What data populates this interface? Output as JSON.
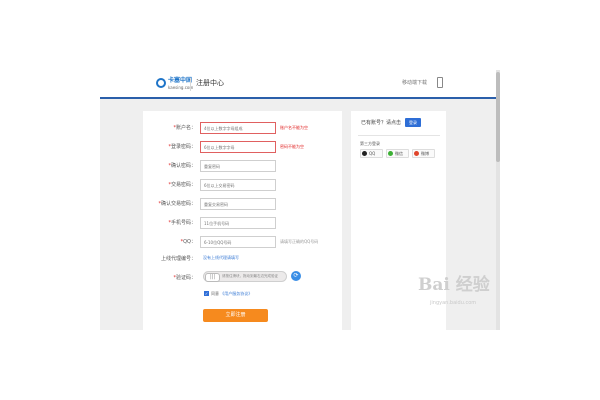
{
  "header": {
    "logo_text": "卡塞中国",
    "logo_sub": "kaesing.com",
    "title": "注册中心",
    "download_text": "移动端下载"
  },
  "form": {
    "fields": [
      {
        "label": "账户名：",
        "placeholder": "4位以上数字字母组成",
        "hint": "账户名不能为空",
        "hint_error": true,
        "error": true
      },
      {
        "label": "登录密码：",
        "placeholder": "6位以上数字字母",
        "hint": "密码不能为空",
        "hint_error": true,
        "error": true
      },
      {
        "label": "确认密码：",
        "placeholder": "重复密码",
        "hint": "",
        "hint_error": false,
        "error": false
      },
      {
        "label": "交易密码：",
        "placeholder": "6位以上交易密码",
        "hint": "",
        "hint_error": false,
        "error": false
      },
      {
        "label": "确认交易密码：",
        "placeholder": "重复交易密码",
        "hint": "",
        "hint_error": false,
        "error": false
      },
      {
        "label": "手机号码：",
        "placeholder": "11位手机号码",
        "hint": "",
        "hint_error": false,
        "error": false
      },
      {
        "label": "QQ：",
        "placeholder": "6-10位QQ号码",
        "hint": "请填写正确的QQ号码",
        "hint_error": false,
        "error": false
      }
    ],
    "referral_label": "上线代理编号：",
    "referral_link": "没有上线代理请填写",
    "captcha_label": "验证码：",
    "captcha_handle": "|||",
    "captcha_text": "请按住滑块，拖动到最右边完成验证",
    "agree_check": "✓",
    "agree_text": "同意",
    "agree_link": "《用户服务协议》",
    "submit_label": "立即注册"
  },
  "side": {
    "login_question": "已有账号？请点击",
    "login_button": "登录",
    "third_title": "第三方登录",
    "social": [
      "QQ",
      "微信",
      "微博"
    ]
  },
  "watermark": {
    "main": "Bai 经验",
    "sub": "jingyan.baidu.com"
  },
  "colors": {
    "accent_blue": "#2b5faa",
    "submit_orange": "#f68a1e",
    "error_red": "#e02020"
  }
}
